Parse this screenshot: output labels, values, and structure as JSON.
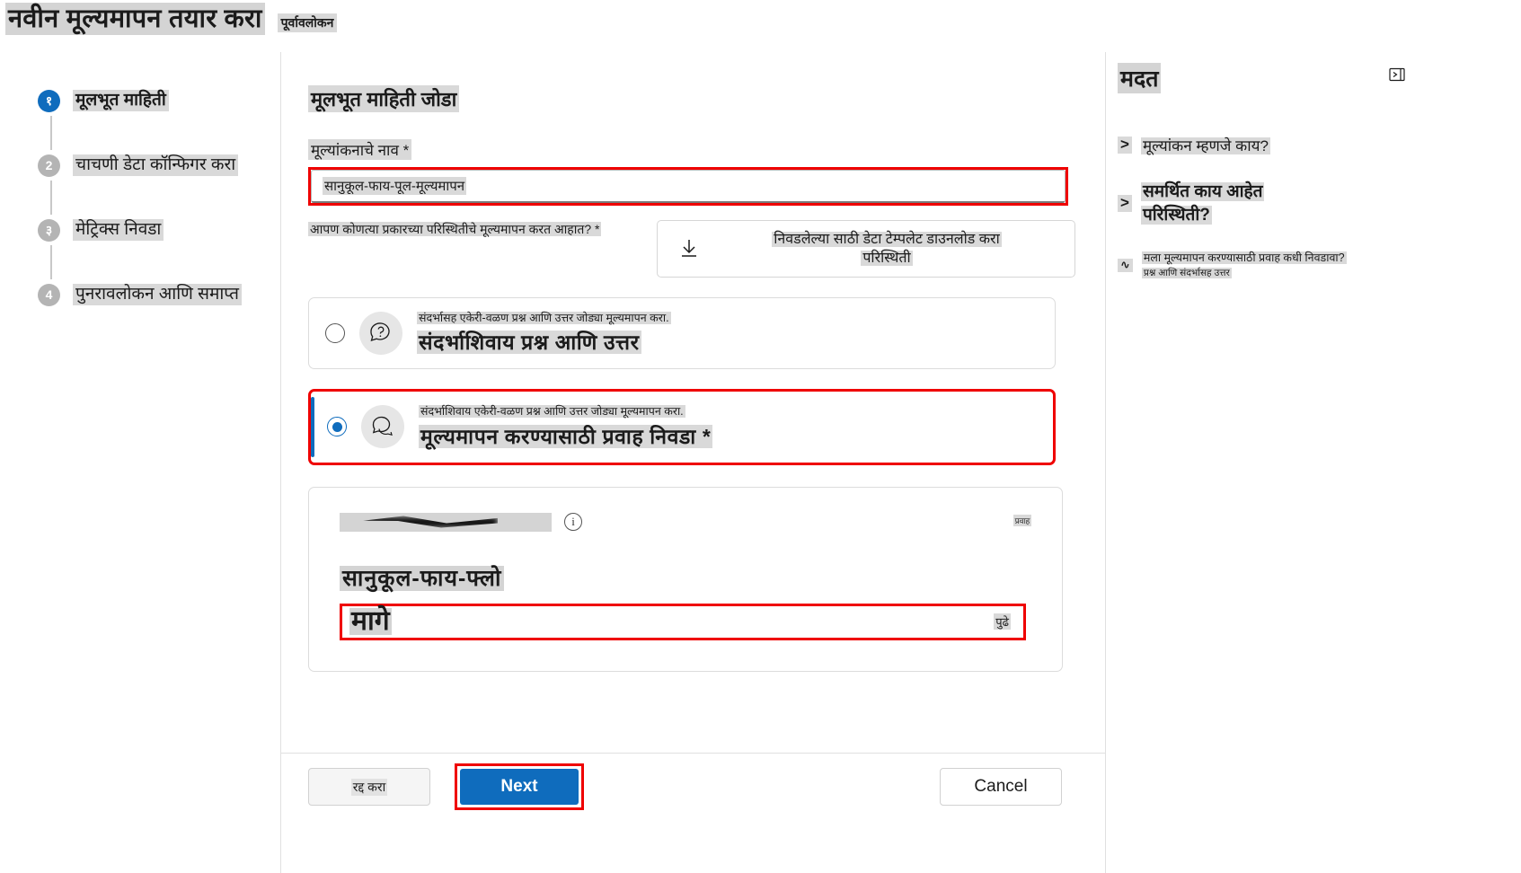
{
  "header": {
    "title": "नवीन मूल्यमापन तयार करा",
    "preview_badge": "पूर्वावलोकन"
  },
  "stepper": {
    "steps": [
      {
        "num": "१",
        "label": "मूलभूत माहिती",
        "state": "active"
      },
      {
        "num": "2",
        "label": "चाचणी डेटा कॉन्फिगर करा",
        "state": "idle"
      },
      {
        "num": "३",
        "label": "मेट्रिक्स निवडा",
        "state": "idle"
      },
      {
        "num": "4",
        "label": "पुनरावलोकन आणि समाप्त",
        "state": "idle"
      }
    ]
  },
  "main": {
    "section_heading": "मूलभूत माहिती जोडा",
    "name_field": {
      "label": "मूल्यांकनाचे नाव *",
      "value": "सानुकूल-फाय-पूल-मूल्यमापन"
    },
    "scenario_question": "आपण कोणत्या प्रकारच्या परिस्थितीचे मूल्यमापन करत आहात? *",
    "download_template": {
      "line1": "निवडलेल्या साठी डेटा टेम्पलेट डाउनलोड करा",
      "line2": "परिस्थिती",
      "icon": "download-icon"
    },
    "options": [
      {
        "id": "qa-without-context",
        "selected": false,
        "description": "संदर्भासह एकेरी-वळण प्रश्न आणि उत्तर जोड्या मूल्यमापन करा.",
        "title": "संदर्भाशिवाय प्रश्न आणि उत्तर",
        "icon": "question-bubble-icon"
      },
      {
        "id": "select-flow",
        "selected": true,
        "description": "संदर्भाशिवाय एकेरी-वळण प्रश्न आणि उत्तर जोड्या मूल्यमापन करा.",
        "title": "मूल्यमापन करण्यासाठी प्रवाह निवडा *",
        "icon": "chat-bubble-icon"
      }
    ],
    "flow_card": {
      "redacted_label": "",
      "info_icon": "info-icon",
      "corner_label": "प्रवाह",
      "flow_name": "सानुकूल-फाय-फ्लो",
      "search_value": "मागे",
      "next_label": "पुढे"
    }
  },
  "footer": {
    "cancel_step_label": "रद्द करा",
    "next_label": "Next",
    "cancel_label": "Cancel"
  },
  "help": {
    "title": "मदत",
    "items": [
      {
        "chevron": ">",
        "text": "मूल्यांकन म्हणजे काय?",
        "size": "lg"
      },
      {
        "chevron": ">",
        "text_line1": "समर्थित काय आहेत",
        "text_line2": "परिस्थिती?",
        "size": "xl"
      },
      {
        "chevron": "∿",
        "text_line1": "मला मूल्यमापन करण्यासाठी प्रवाह कधी निवडावा?",
        "text_line2": "प्रश्न आणि संदर्भासह उत्तर",
        "size": "sm"
      }
    ],
    "collapse_icon": "collapse-panel-icon"
  },
  "colors": {
    "accent": "#0f6cbd",
    "highlight": "#ef0000",
    "muted": "#b4b4b4"
  }
}
